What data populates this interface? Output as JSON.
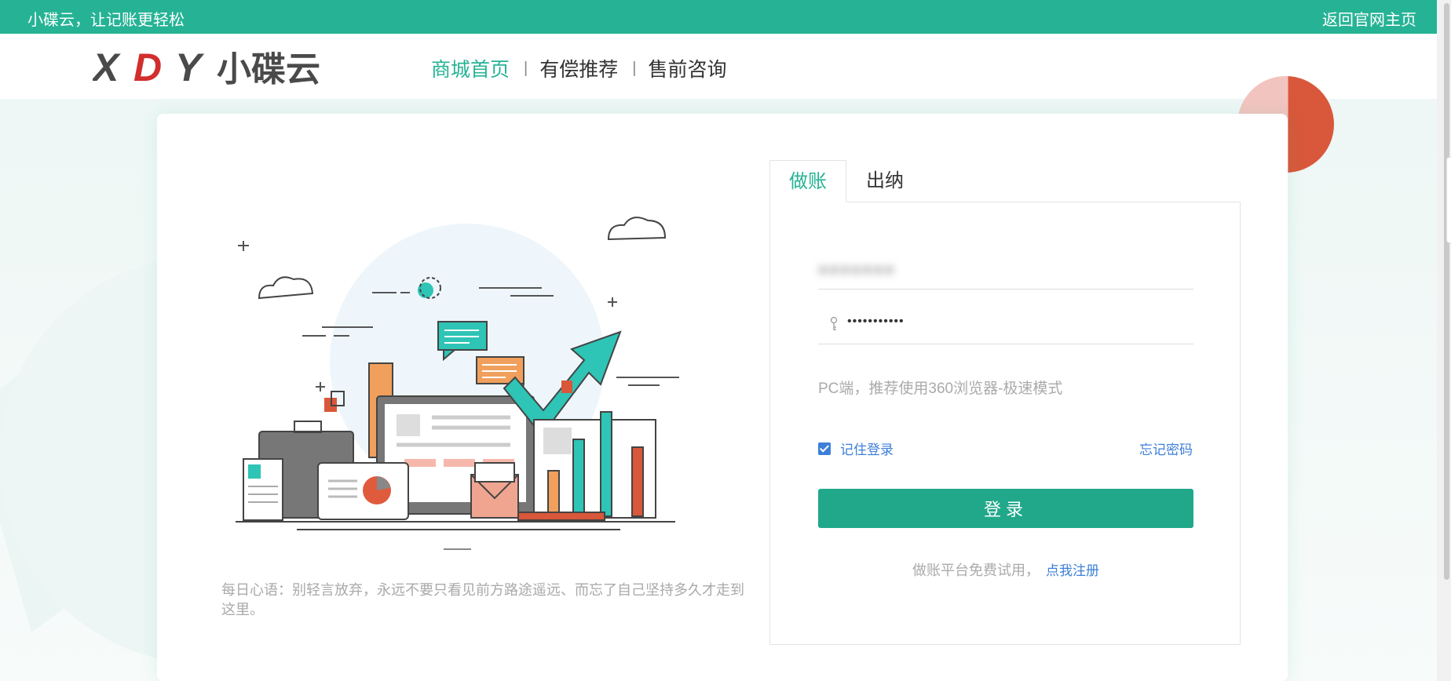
{
  "topbar": {
    "slogan": "小碟云，让记账更轻松",
    "back_link": "返回官网主页"
  },
  "header": {
    "logo_text": "XDY小碟云",
    "nav": [
      {
        "label": "商城首页",
        "active": true
      },
      {
        "label": "有偿推荐",
        "active": false
      },
      {
        "label": "售前咨询",
        "active": false
      }
    ],
    "nav_separator": "|"
  },
  "illustration": {
    "quote": "每日心语：别轻言放弃，永远不要只看见前方路途遥远、而忘了自己坚持多久才走到这里。"
  },
  "login": {
    "tabs": [
      {
        "label": "做账",
        "active": true
      },
      {
        "label": "出纳",
        "active": false
      }
    ],
    "username_value": "■■■■■■■",
    "password_value": "•••••••••••",
    "hint": "PC端，推荐使用360浏览器-极速模式",
    "remember_label": "记住登录",
    "remember_checked": true,
    "forgot_label": "忘记密码",
    "submit_label": "登录",
    "register_prompt": "做账平台免费试用，",
    "register_link": "点我注册"
  },
  "colors": {
    "brand": "#26b395",
    "button": "#21a88b",
    "link": "#3d7fd8",
    "accent_red": "#d9573a"
  }
}
